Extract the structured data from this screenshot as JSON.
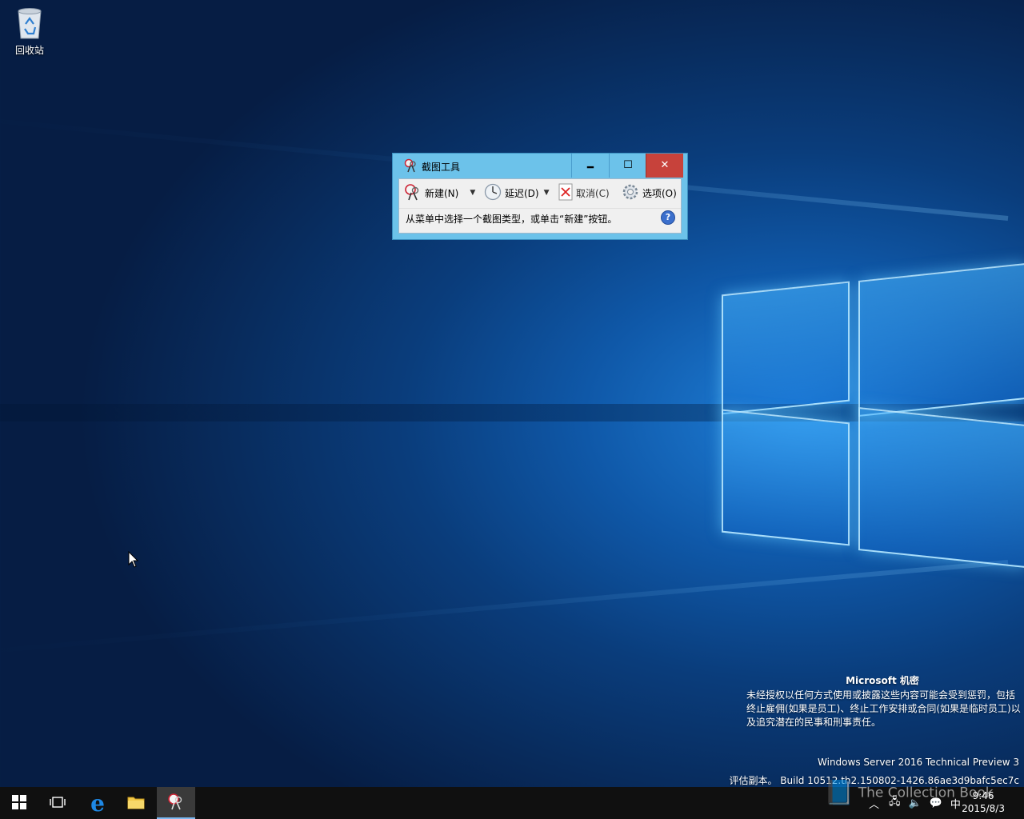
{
  "desktop": {
    "recycle_bin_label": "回收站"
  },
  "snip_window": {
    "title": "截图工具",
    "minimize_glyph": "🗕",
    "maximize_glyph": "☐",
    "close_glyph": "✕",
    "toolbar": {
      "new_label": "新建(N)",
      "delay_label": "延迟(D)",
      "cancel_label": "取消(C)",
      "options_label": "选项(O)"
    },
    "status_text": "从菜单中选择一个截图类型，或单击“新建”按钮。",
    "help_glyph": "?"
  },
  "watermark": {
    "title": "Microsoft 机密",
    "body": "未经授权以任何方式使用或披露这些内容可能会受到惩罚，包括终止雇佣(如果是员工)、终止工作安排或合同(如果是临时员工)以及追究潜在的民事和刑事责任。",
    "edition": "Windows Server 2016 Technical Preview 3",
    "build": "评估副本。 Build 10512.th2.150802-1426.86ae3d9bafc5ec7c"
  },
  "taskbar": {
    "ime_label": "中",
    "clock_time": "9:46",
    "clock_date": "2015/8/3",
    "overlay_text": "The Collection Book"
  },
  "colors": {
    "accent": "#6cc2ea",
    "close_red": "#c7423b",
    "taskbar": "#101010"
  }
}
